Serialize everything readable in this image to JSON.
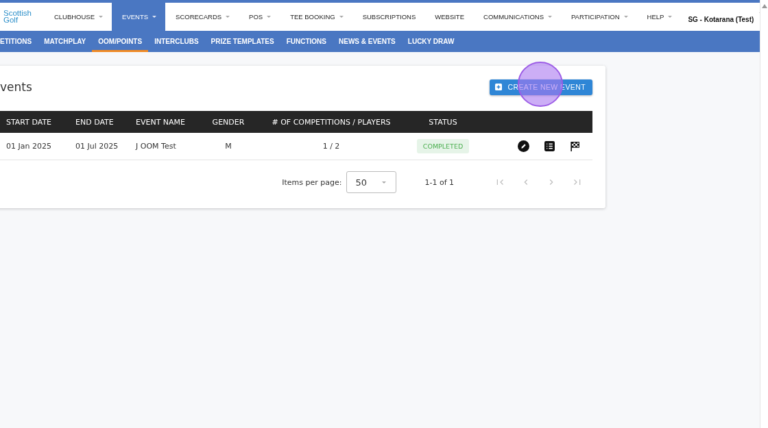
{
  "logo": {
    "line1": "Scottish",
    "line2": "Golf"
  },
  "nav": {
    "items": [
      {
        "label": "CLUBHOUSE",
        "selected": false,
        "dropdown": true
      },
      {
        "label": "EVENTS",
        "selected": true,
        "dropdown": true
      },
      {
        "label": "SCORECARDS",
        "selected": false,
        "dropdown": true
      },
      {
        "label": "POS",
        "selected": false,
        "dropdown": true
      },
      {
        "label": "TEE BOOKING",
        "selected": false,
        "dropdown": true
      },
      {
        "label": "SUBSCRIPTIONS",
        "selected": false,
        "dropdown": false
      },
      {
        "label": "WEBSITE",
        "selected": false,
        "dropdown": false
      },
      {
        "label": "COMMUNICATIONS",
        "selected": false,
        "dropdown": true
      },
      {
        "label": "PARTICIPATION",
        "selected": false,
        "dropdown": true
      },
      {
        "label": "HELP",
        "selected": false,
        "dropdown": true
      }
    ],
    "user": "SG - Kotarana (Test)"
  },
  "subnav": {
    "items": [
      {
        "label": "ETITIONS",
        "selected": false
      },
      {
        "label": "MATCHPLAY",
        "selected": false
      },
      {
        "label": "OOM/POINTS",
        "selected": true
      },
      {
        "label": "INTERCLUBS",
        "selected": false
      },
      {
        "label": "PRIZE TEMPLATES",
        "selected": false
      },
      {
        "label": "FUNCTIONS",
        "selected": false
      },
      {
        "label": "NEWS & EVENTS",
        "selected": false
      },
      {
        "label": "LUCKY DRAW",
        "selected": false
      }
    ]
  },
  "card": {
    "title": "vents",
    "create_button": "CREATE NEW EVENT",
    "table": {
      "columns": [
        "START DATE",
        "END DATE",
        "EVENT NAME",
        "GENDER",
        "# OF COMPETITIONS / PLAYERS",
        "STATUS"
      ],
      "rows": [
        {
          "start_date": "01 Jan 2025",
          "end_date": "01 Jul 2025",
          "event_name": "J OOM Test",
          "gender": "M",
          "competitions_players": "1 / 2",
          "status": "COMPLETED"
        }
      ]
    },
    "pagination": {
      "items_per_page_label": "Items per page:",
      "items_per_page": "50",
      "range": "1-1 of 1",
      "buttons": [
        {
          "kind": "first",
          "disabled": true
        },
        {
          "kind": "prev",
          "disabled": true
        },
        {
          "kind": "next",
          "disabled": true
        },
        {
          "kind": "last",
          "disabled": true
        }
      ]
    }
  }
}
